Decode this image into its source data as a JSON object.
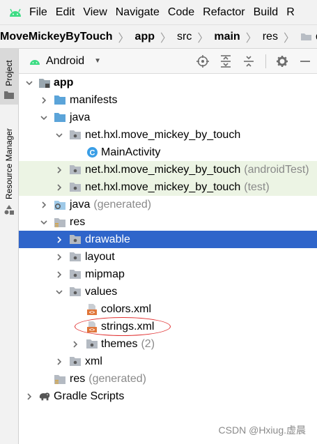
{
  "menu": [
    "File",
    "Edit",
    "View",
    "Navigate",
    "Code",
    "Refactor",
    "Build",
    "R"
  ],
  "breadcrumb": [
    "MoveMickeyByTouch",
    "app",
    "src",
    "main",
    "res",
    "drawa"
  ],
  "stripe": {
    "project_tab": "Project",
    "resource_tab": "Resource Manager"
  },
  "tool_window": {
    "view_mode": "Android",
    "icons": [
      "locate-icon",
      "expand-all-icon",
      "collapse-all-icon",
      "gear-icon",
      "minimize-icon"
    ]
  },
  "tree": [
    {
      "label": "app",
      "suffix": "",
      "depth": 0,
      "arrow": "down",
      "icon": "module-folder-icon",
      "bold": true
    },
    {
      "label": "manifests",
      "suffix": "",
      "depth": 1,
      "arrow": "right",
      "icon": "folder-blue-icon"
    },
    {
      "label": "java",
      "suffix": "",
      "depth": 1,
      "arrow": "down",
      "icon": "folder-blue-icon"
    },
    {
      "label": "net.hxl.move_mickey_by_touch",
      "suffix": "",
      "depth": 2,
      "arrow": "down",
      "icon": "package-icon"
    },
    {
      "label": "MainActivity",
      "suffix": "",
      "depth": 3,
      "arrow": "none",
      "icon": "class-icon"
    },
    {
      "label": "net.hxl.move_mickey_by_touch",
      "suffix": "(androidTest)",
      "depth": 2,
      "arrow": "right",
      "icon": "package-icon",
      "green": true
    },
    {
      "label": "net.hxl.move_mickey_by_touch",
      "suffix": "(test)",
      "depth": 2,
      "arrow": "right",
      "icon": "package-icon",
      "green": true
    },
    {
      "label": "java",
      "suffix": "(generated)",
      "depth": 1,
      "arrow": "right",
      "icon": "generated-folder-icon"
    },
    {
      "label": "res",
      "suffix": "",
      "depth": 1,
      "arrow": "down",
      "icon": "res-folder-icon"
    },
    {
      "label": "drawable",
      "suffix": "",
      "depth": 2,
      "arrow": "right",
      "icon": "package-icon",
      "selected": true
    },
    {
      "label": "layout",
      "suffix": "",
      "depth": 2,
      "arrow": "right",
      "icon": "package-icon"
    },
    {
      "label": "mipmap",
      "suffix": "",
      "depth": 2,
      "arrow": "right",
      "icon": "package-icon"
    },
    {
      "label": "values",
      "suffix": "",
      "depth": 2,
      "arrow": "down",
      "icon": "package-icon"
    },
    {
      "label": "colors.xml",
      "suffix": "",
      "depth": 3,
      "arrow": "none",
      "icon": "xml-file-icon"
    },
    {
      "label": "strings.xml",
      "suffix": "",
      "depth": 3,
      "arrow": "none",
      "icon": "xml-file-icon"
    },
    {
      "label": "themes",
      "suffix": "(2)",
      "depth": 3,
      "arrow": "right",
      "icon": "package-icon"
    },
    {
      "label": "xml",
      "suffix": "",
      "depth": 2,
      "arrow": "right",
      "icon": "package-icon"
    },
    {
      "label": "res",
      "suffix": "(generated)",
      "depth": 1,
      "arrow": "none",
      "icon": "res-folder-icon"
    },
    {
      "label": "Gradle Scripts",
      "suffix": "",
      "depth": 0,
      "arrow": "right",
      "icon": "gradle-elephant-icon"
    }
  ],
  "watermark": "CSDN @Hxiug.虚晨",
  "colors": {
    "selection": "#2f65ca",
    "test_highlight": "#ecf4e4",
    "annotation_circle": "#e03030",
    "android_green": "#3ddc84"
  }
}
